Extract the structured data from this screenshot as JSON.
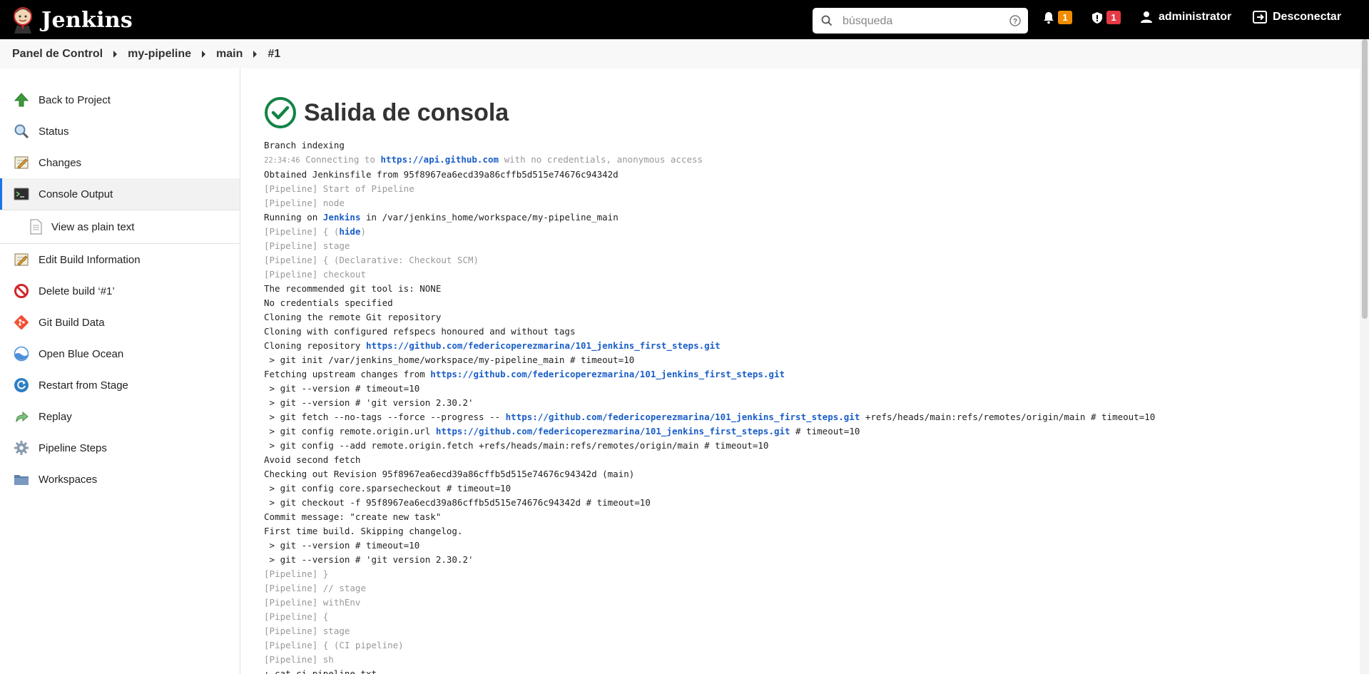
{
  "header": {
    "brand": "Jenkins",
    "search_placeholder": "búsqueda",
    "notifications_count": "1",
    "security_count": "1",
    "user": "administrator",
    "logout": "Desconectar"
  },
  "breadcrumb": [
    "Panel de Control",
    "my-pipeline",
    "main",
    "#1"
  ],
  "sidebar": {
    "items": [
      {
        "label": "Back to Project",
        "icon": "up-arrow-icon"
      },
      {
        "label": "Status",
        "icon": "magnifier-icon"
      },
      {
        "label": "Changes",
        "icon": "notepad-icon"
      },
      {
        "label": "Console Output",
        "icon": "terminal-icon"
      },
      {
        "label": "View as plain text",
        "icon": "document-icon"
      },
      {
        "label": "Edit Build Information",
        "icon": "notepad-icon"
      },
      {
        "label": "Delete build ‘#1’",
        "icon": "no-entry-icon"
      },
      {
        "label": "Git Build Data",
        "icon": "git-icon"
      },
      {
        "label": "Open Blue Ocean",
        "icon": "blue-ocean-icon"
      },
      {
        "label": "Restart from Stage",
        "icon": "restart-icon"
      },
      {
        "label": "Replay",
        "icon": "replay-arrow-icon"
      },
      {
        "label": "Pipeline Steps",
        "icon": "gear-icon"
      },
      {
        "label": "Workspaces",
        "icon": "folder-icon"
      }
    ]
  },
  "main": {
    "title": "Salida de consola",
    "status": "success",
    "console": {
      "branch_indexing": "Branch indexing",
      "timestamp": "22:34:46",
      "connecting_prefix": " Connecting to ",
      "api_link": "https://api.github.com",
      "connecting_suffix": " with no credentials, anonymous access",
      "obtained": "Obtained Jenkinsfile from 95f8967ea6ecd39a86cffb5d515e74676c94342d",
      "start_pipeline": "[Pipeline] Start of Pipeline",
      "node": "[Pipeline] node",
      "running_prefix": "Running on ",
      "running_link": "Jenkins",
      "running_suffix": " in /var/jenkins_home/workspace/my-pipeline_main",
      "brace_hide_prefix": "[Pipeline] { (",
      "hide_link": "hide",
      "brace_hide_suffix": ")",
      "stage1": "[Pipeline] stage",
      "decl_checkout": "[Pipeline] { (Declarative: Checkout SCM)",
      "checkout": "[Pipeline] checkout",
      "git_tool": "The recommended git tool is: NONE",
      "no_creds": "No credentials specified",
      "cloning_remote": "Cloning the remote Git repository",
      "cloning_refspecs": "Cloning with configured refspecs honoured and without tags",
      "cloning_repo_prefix": "Cloning repository ",
      "repo_url": "https://github.com/federicoperezmarina/101_jenkins_first_steps.git",
      "git_init": " > git init /var/jenkins_home/workspace/my-pipeline_main # timeout=10",
      "fetching_prefix": "Fetching upstream changes from ",
      "git_version1": " > git --version # timeout=10",
      "git_version2": " > git --version # 'git version 2.30.2'",
      "git_fetch_prefix": " > git fetch --no-tags --force --progress -- ",
      "git_fetch_suffix": " +refs/heads/main:refs/remotes/origin/main # timeout=10",
      "git_config_url_prefix": " > git config remote.origin.url ",
      "git_config_url_suffix": " # timeout=10",
      "git_config_fetch": " > git config --add remote.origin.fetch +refs/heads/main:refs/remotes/origin/main # timeout=10",
      "avoid_fetch": "Avoid second fetch",
      "checking_out": "Checking out Revision 95f8967ea6ecd39a86cffb5d515e74676c94342d (main)",
      "sparse": " > git config core.sparsecheckout # timeout=10",
      "git_checkout": " > git checkout -f 95f8967ea6ecd39a86cffb5d515e74676c94342d # timeout=10",
      "commit_msg": "Commit message: \"create new task\"",
      "first_build": "First time build. Skipping changelog.",
      "git_version3": " > git --version # timeout=10",
      "git_version4": " > git --version # 'git version 2.30.2'",
      "close_brace": "[Pipeline] }",
      "stage_comment": "[Pipeline] // stage",
      "with_env": "[Pipeline] withEnv",
      "open_brace": "[Pipeline] {",
      "stage2": "[Pipeline] stage",
      "ci_pipeline": "[Pipeline] { (CI pipeline)",
      "sh": "[Pipeline] sh",
      "cat_cmd": "+ cat ci_pipeline.txt"
    }
  }
}
